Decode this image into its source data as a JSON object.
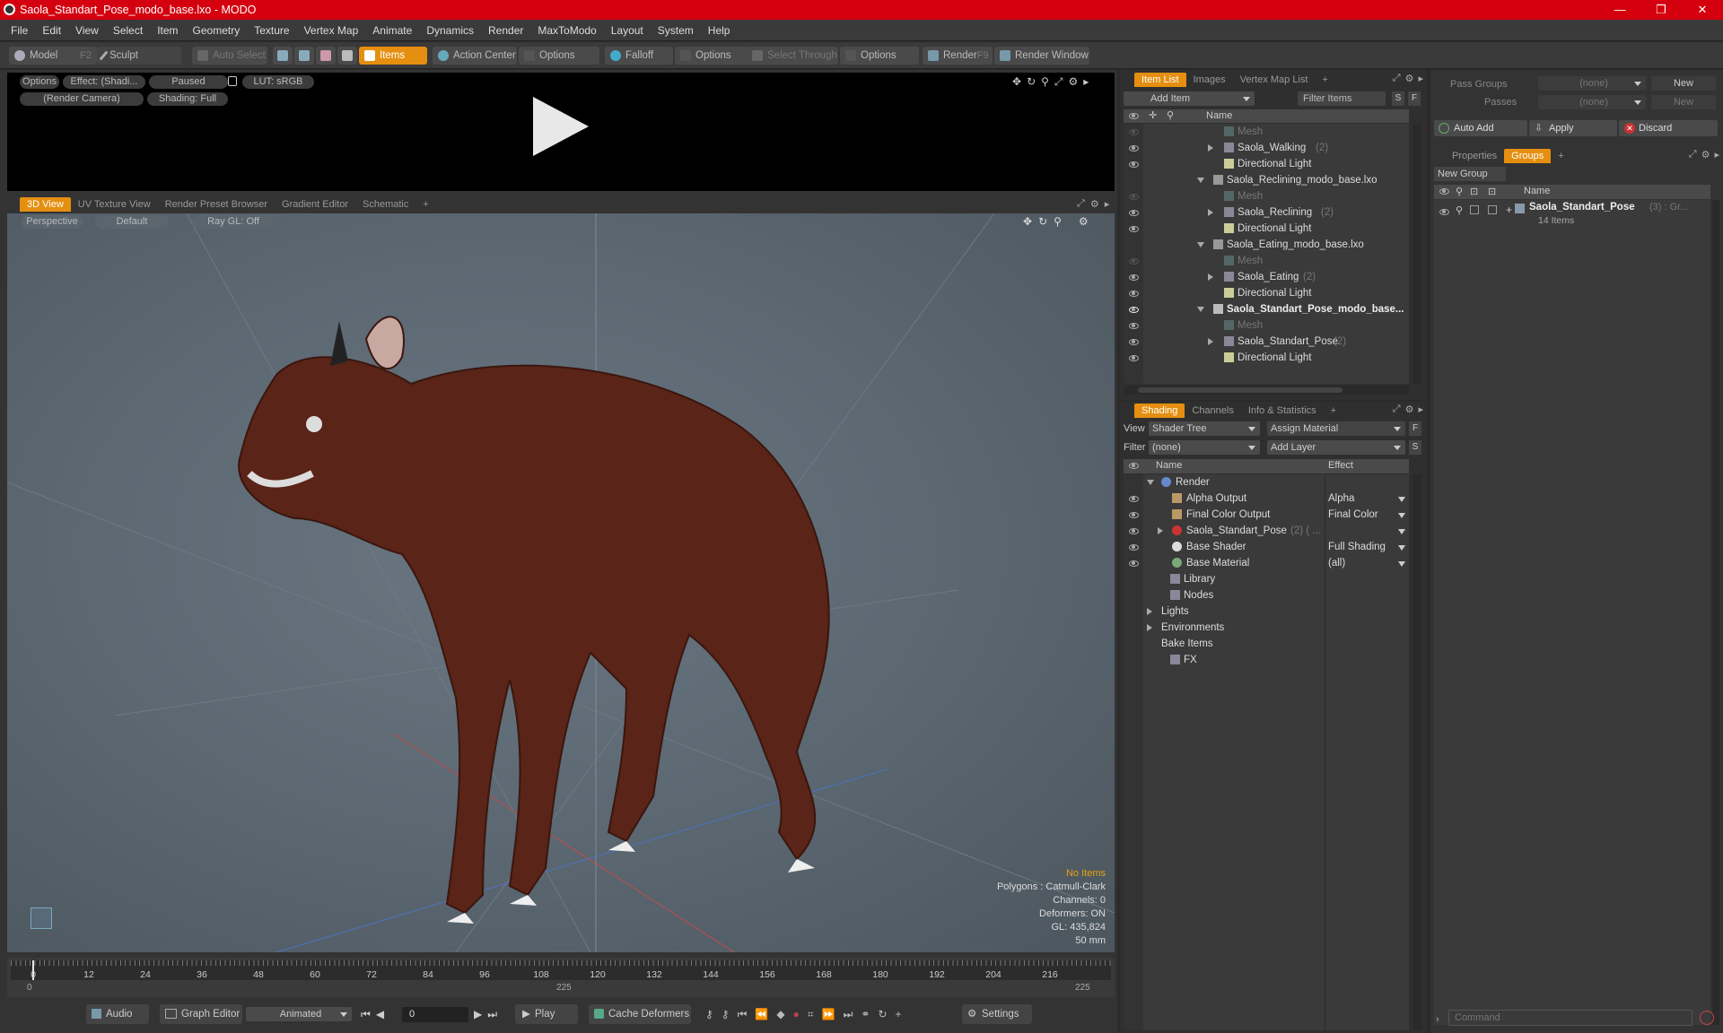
{
  "window": {
    "title": "Saola_Standart_Pose_modo_base.lxo - MODO",
    "minimize": "—",
    "maximize": "❐",
    "close": "✕"
  },
  "menu": [
    "File",
    "Edit",
    "View",
    "Select",
    "Item",
    "Geometry",
    "Texture",
    "Vertex Map",
    "Animate",
    "Dynamics",
    "Render",
    "MaxToModo",
    "Layout",
    "System",
    "Help"
  ],
  "toolbar": {
    "model": "Model",
    "model_key": "F2",
    "sculpt": "Sculpt",
    "auto_select": "Auto Select",
    "items": "Items",
    "action_center": "Action Center",
    "options1": "Options",
    "falloff": "Falloff",
    "options2": "Options",
    "select_through": "Select Through",
    "options3": "Options",
    "render": "Render",
    "render_key": "F9",
    "render_window": "Render Window"
  },
  "preview": {
    "options": "Options",
    "effect": "Effect: (Shadi...",
    "paused": "Paused",
    "lut": "LUT: sRGB",
    "camera": "(Render Camera)",
    "shading": "Shading: Full"
  },
  "viewport_tabs": [
    "3D View",
    "UV Texture View",
    "Render Preset Browser",
    "Gradient Editor",
    "Schematic",
    "+"
  ],
  "viewport": {
    "perspective": "Perspective",
    "default": "Default",
    "raygl": "Ray GL: Off"
  },
  "hud": {
    "no_items": "No Items",
    "polygons": "Polygons : Catmull-Clark",
    "channels": "Channels: 0",
    "deformers": "Deformers: ON",
    "gl": "GL: 435,824",
    "mm": "50 mm"
  },
  "timeline": {
    "ticks": [
      "0",
      "12",
      "24",
      "36",
      "48",
      "60",
      "72",
      "84",
      "96",
      "108",
      "120",
      "132",
      "144",
      "156",
      "168",
      "180",
      "192",
      "204",
      "216"
    ],
    "start": "0",
    "mid": "225",
    "end": "225"
  },
  "bottom": {
    "audio": "Audio",
    "graph_editor": "Graph Editor",
    "animated": "Animated",
    "frame": "0",
    "play": "Play",
    "cache": "Cache Deformers",
    "settings": "Settings"
  },
  "item_list": {
    "tabs": [
      "Item List",
      "Images",
      "Vertex Map List",
      "+"
    ],
    "add_item": "Add Item",
    "filter_items": "Filter Items",
    "s": "S",
    "f": "F",
    "col_name": "Name",
    "rows": [
      {
        "label": "Mesh",
        "count": ""
      },
      {
        "label": "Saola_Walking",
        "count": "(2)"
      },
      {
        "label": "Directional Light",
        "count": ""
      },
      {
        "label": "Saola_Reclining_modo_base.lxo",
        "count": ""
      },
      {
        "label": "Mesh",
        "count": ""
      },
      {
        "label": "Saola_Reclining",
        "count": "(2)"
      },
      {
        "label": "Directional Light",
        "count": ""
      },
      {
        "label": "Saola_Eating_modo_base.lxo",
        "count": ""
      },
      {
        "label": "Mesh",
        "count": ""
      },
      {
        "label": "Saola_Eating",
        "count": "(2)"
      },
      {
        "label": "Directional Light",
        "count": ""
      },
      {
        "label": "Saola_Standart_Pose_modo_base...",
        "count": ""
      },
      {
        "label": "Mesh",
        "count": ""
      },
      {
        "label": "Saola_Standart_Pose",
        "count": "(2)"
      },
      {
        "label": "Directional Light",
        "count": ""
      }
    ]
  },
  "shading": {
    "tabs": [
      "Shading",
      "Channels",
      "Info & Statistics",
      "+"
    ],
    "view_label": "View",
    "view_value": "Shader Tree",
    "assign_material": "Assign Material",
    "f": "F",
    "filter_label": "Filter",
    "filter_value": "(none)",
    "add_layer": "Add Layer",
    "s": "S",
    "col_name": "Name",
    "col_effect": "Effect",
    "rows": [
      {
        "label": "Render",
        "effect": ""
      },
      {
        "label": "Alpha Output",
        "effect": "Alpha"
      },
      {
        "label": "Final Color Output",
        "effect": "Final Color"
      },
      {
        "label": "Saola_Standart_Pose",
        "sub": "(2) ( ...",
        "effect": ""
      },
      {
        "label": "Base Shader",
        "effect": "Full Shading"
      },
      {
        "label": "Base Material",
        "effect": "(all)"
      },
      {
        "label": "Library",
        "effect": ""
      },
      {
        "label": "Nodes",
        "effect": ""
      },
      {
        "label": "Lights",
        "effect": ""
      },
      {
        "label": "Environments",
        "effect": ""
      },
      {
        "label": "Bake Items",
        "effect": ""
      },
      {
        "label": "FX",
        "effect": ""
      }
    ]
  },
  "groups": {
    "pass_groups_label": "Pass Groups",
    "pass_groups_value": "(none)",
    "passes_label": "Passes",
    "passes_value": "(none)",
    "new": "New",
    "new2": "New",
    "auto_add": "Auto Add",
    "apply": "Apply",
    "discard": "Discard",
    "tabs": [
      "Properties",
      "Groups",
      "+"
    ],
    "new_group": "New Group",
    "col_name": "Name",
    "group_name": "Saola_Standart_Pose",
    "group_suffix": "(3) : Gr...",
    "group_items": "14 Items",
    "command_placeholder": "Command"
  }
}
